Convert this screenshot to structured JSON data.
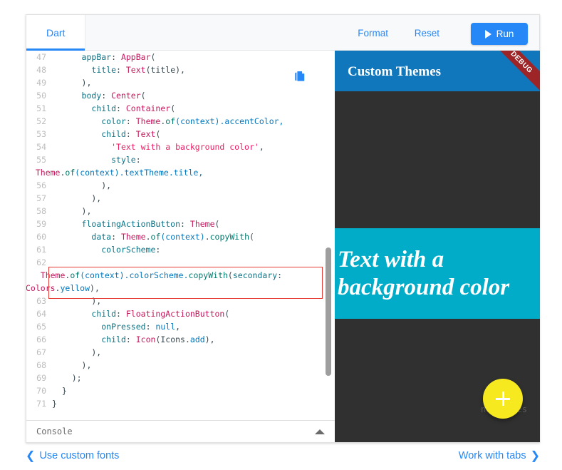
{
  "toolbar": {
    "tab_label": "Dart",
    "format_label": "Format",
    "reset_label": "Reset",
    "run_label": "Run",
    "accent_color": "#2688f7"
  },
  "editor": {
    "copy_icon": "copy-icon",
    "scrollbar": "vertical-scrollbar",
    "lines": [
      {
        "num": "47",
        "tokens": [
          {
            "t": "      ",
            "c": "pln"
          },
          {
            "t": "appBar",
            "c": "kw"
          },
          {
            "t": ": ",
            "c": "pln"
          },
          {
            "t": "AppBar",
            "c": "typ"
          },
          {
            "t": "(",
            "c": "pln"
          }
        ]
      },
      {
        "num": "48",
        "tokens": [
          {
            "t": "        ",
            "c": "pln"
          },
          {
            "t": "title",
            "c": "kw"
          },
          {
            "t": ": ",
            "c": "pln"
          },
          {
            "t": "Text",
            "c": "typ"
          },
          {
            "t": "(title),",
            "c": "pln"
          }
        ]
      },
      {
        "num": "49",
        "tokens": [
          {
            "t": "      ),",
            "c": "pln"
          }
        ]
      },
      {
        "num": "50",
        "tokens": [
          {
            "t": "      ",
            "c": "pln"
          },
          {
            "t": "body",
            "c": "kw"
          },
          {
            "t": ": ",
            "c": "pln"
          },
          {
            "t": "Center",
            "c": "typ"
          },
          {
            "t": "(",
            "c": "pln"
          }
        ]
      },
      {
        "num": "51",
        "tokens": [
          {
            "t": "        ",
            "c": "pln"
          },
          {
            "t": "child",
            "c": "kw"
          },
          {
            "t": ": ",
            "c": "pln"
          },
          {
            "t": "Container",
            "c": "typ"
          },
          {
            "t": "(",
            "c": "pln"
          }
        ]
      },
      {
        "num": "52",
        "tokens": [
          {
            "t": "          ",
            "c": "pln"
          },
          {
            "t": "color",
            "c": "kw"
          },
          {
            "t": ": ",
            "c": "pln"
          },
          {
            "t": "Theme",
            "c": "typ"
          },
          {
            "t": ".",
            "c": "pln"
          },
          {
            "t": "of",
            "c": "mth"
          },
          {
            "t": "(context)",
            "c": "prp"
          },
          {
            "t": ".accentColor,",
            "c": "prp"
          }
        ]
      },
      {
        "num": "53",
        "tokens": [
          {
            "t": "          ",
            "c": "pln"
          },
          {
            "t": "child",
            "c": "kw"
          },
          {
            "t": ": ",
            "c": "pln"
          },
          {
            "t": "Text",
            "c": "typ"
          },
          {
            "t": "(",
            "c": "pln"
          }
        ]
      },
      {
        "num": "54",
        "tokens": [
          {
            "t": "            ",
            "c": "pln"
          },
          {
            "t": "'Text with a background color'",
            "c": "str"
          },
          {
            "t": ",",
            "c": "pln"
          }
        ]
      },
      {
        "num": "55",
        "tokens": [
          {
            "t": "            ",
            "c": "pln"
          },
          {
            "t": "style",
            "c": "kw"
          },
          {
            "t": ":",
            "c": "pln"
          }
        ],
        "wrap_tokens": [
          {
            "t": "  ",
            "c": "pln"
          },
          {
            "t": "Theme",
            "c": "typ"
          },
          {
            "t": ".",
            "c": "pln"
          },
          {
            "t": "of",
            "c": "mth"
          },
          {
            "t": "(context)",
            "c": "prp"
          },
          {
            "t": ".textTheme.title,",
            "c": "prp"
          }
        ]
      },
      {
        "num": "56",
        "tokens": [
          {
            "t": "          ),",
            "c": "pln"
          }
        ]
      },
      {
        "num": "57",
        "tokens": [
          {
            "t": "        ),",
            "c": "pln"
          }
        ]
      },
      {
        "num": "58",
        "tokens": [
          {
            "t": "      ),",
            "c": "pln"
          }
        ]
      },
      {
        "num": "59",
        "tokens": [
          {
            "t": "      ",
            "c": "pln"
          },
          {
            "t": "floatingActionButton",
            "c": "kw"
          },
          {
            "t": ": ",
            "c": "pln"
          },
          {
            "t": "Theme",
            "c": "typ"
          },
          {
            "t": "(",
            "c": "pln"
          }
        ]
      },
      {
        "num": "60",
        "tokens": [
          {
            "t": "        ",
            "c": "pln"
          },
          {
            "t": "data",
            "c": "kw"
          },
          {
            "t": ": ",
            "c": "pln"
          },
          {
            "t": "Theme",
            "c": "typ"
          },
          {
            "t": ".",
            "c": "pln"
          },
          {
            "t": "of",
            "c": "mth"
          },
          {
            "t": "(context)",
            "c": "prp"
          },
          {
            "t": ".",
            "c": "pln"
          },
          {
            "t": "copyWith",
            "c": "mth"
          },
          {
            "t": "(",
            "c": "pln"
          }
        ]
      },
      {
        "num": "61",
        "tokens": [
          {
            "t": "          ",
            "c": "pln"
          },
          {
            "t": "colorScheme",
            "c": "kw"
          },
          {
            "t": ":",
            "c": "pln"
          }
        ]
      },
      {
        "num": "62",
        "tokens": [],
        "wrap_tokens": [
          {
            "t": "   ",
            "c": "pln"
          },
          {
            "t": "Theme",
            "c": "typ"
          },
          {
            "t": ".",
            "c": "pln"
          },
          {
            "t": "of",
            "c": "mth"
          },
          {
            "t": "(context)",
            "c": "prp"
          },
          {
            "t": ".colorScheme.",
            "c": "prp"
          },
          {
            "t": "copyWith",
            "c": "mth"
          },
          {
            "t": "(",
            "c": "pln"
          },
          {
            "t": "secondary",
            "c": "kw"
          },
          {
            "t": ":",
            "c": "pln"
          }
        ],
        "wrap_tokens2": [
          {
            "t": "Colors",
            "c": "typ"
          },
          {
            "t": ".",
            "c": "pln"
          },
          {
            "t": "yellow",
            "c": "prp"
          },
          {
            "t": "),",
            "c": "pln"
          }
        ],
        "highlighted": true
      },
      {
        "num": "63",
        "tokens": [
          {
            "t": "        ),",
            "c": "pln"
          }
        ]
      },
      {
        "num": "64",
        "tokens": [
          {
            "t": "        ",
            "c": "pln"
          },
          {
            "t": "child",
            "c": "kw"
          },
          {
            "t": ": ",
            "c": "pln"
          },
          {
            "t": "FloatingActionButton",
            "c": "typ"
          },
          {
            "t": "(",
            "c": "pln"
          }
        ]
      },
      {
        "num": "65",
        "tokens": [
          {
            "t": "          ",
            "c": "pln"
          },
          {
            "t": "onPressed",
            "c": "kw"
          },
          {
            "t": ": ",
            "c": "pln"
          },
          {
            "t": "null",
            "c": "prp"
          },
          {
            "t": ",",
            "c": "pln"
          }
        ]
      },
      {
        "num": "66",
        "tokens": [
          {
            "t": "          ",
            "c": "pln"
          },
          {
            "t": "child",
            "c": "kw"
          },
          {
            "t": ": ",
            "c": "pln"
          },
          {
            "t": "Icon",
            "c": "typ"
          },
          {
            "t": "(Icons.",
            "c": "pln"
          },
          {
            "t": "add",
            "c": "prp"
          },
          {
            "t": "),",
            "c": "pln"
          }
        ]
      },
      {
        "num": "67",
        "tokens": [
          {
            "t": "        ),",
            "c": "pln"
          }
        ]
      },
      {
        "num": "68",
        "tokens": [
          {
            "t": "      ),",
            "c": "pln"
          }
        ]
      },
      {
        "num": "69",
        "tokens": [
          {
            "t": "    );",
            "c": "pln"
          }
        ]
      },
      {
        "num": "70",
        "tokens": [
          {
            "t": "  }",
            "c": "pln"
          }
        ]
      },
      {
        "num": "71",
        "tokens": [
          {
            "t": "}",
            "c": "pln"
          }
        ]
      }
    ]
  },
  "console": {
    "label": "Console",
    "chevron_icon": "chevron-up-icon"
  },
  "preview": {
    "app_bar_title": "Custom Themes",
    "app_bar_color": "#1077bc",
    "debug_label": "DEBUG",
    "debug_color": "#9e2527",
    "background_color": "#303030",
    "block_text": "Text with a background color",
    "block_color": "#00acc7",
    "fab_icon": "plus-icon",
    "fab_color": "#f7e920",
    "status_text": "no issues"
  },
  "bottom_nav": {
    "prev_chevron": "❮",
    "prev_label": "Use custom fonts",
    "next_label": "Work with tabs",
    "next_chevron": "❯"
  }
}
